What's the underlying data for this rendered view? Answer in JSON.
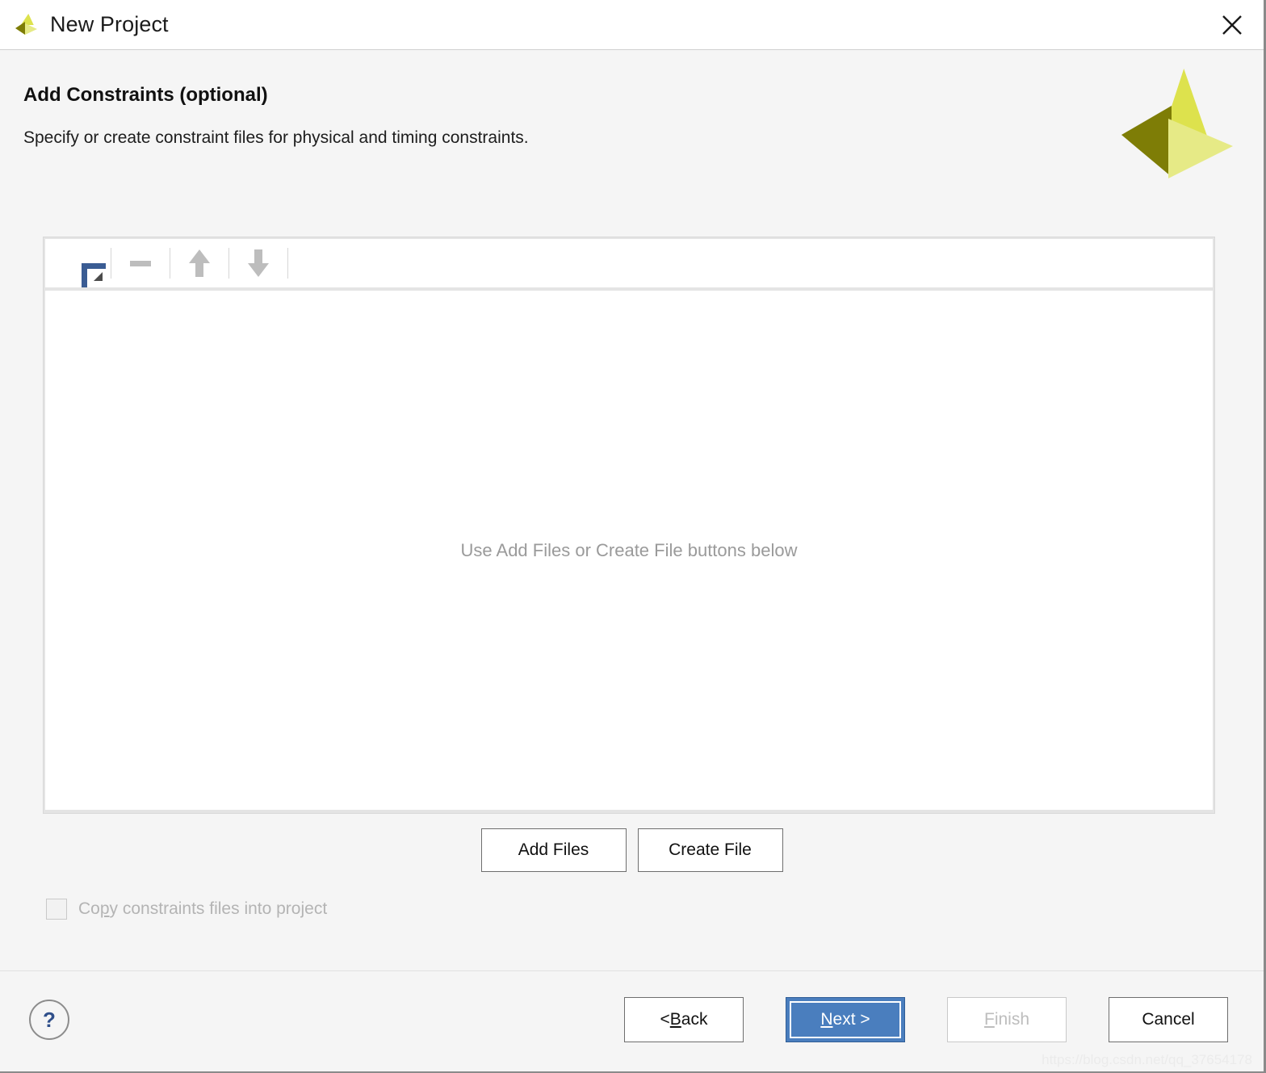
{
  "window": {
    "title": "New Project",
    "close_icon": "close-icon",
    "logo_icon": "xilinx-logo-icon"
  },
  "header": {
    "title": "Add Constraints (optional)",
    "subtitle": "Specify or create constraint files for physical and timing constraints."
  },
  "panel": {
    "toolbar": {
      "add_icon": "plus-icon",
      "remove_icon": "minus-icon",
      "move_up_icon": "arrow-up-icon",
      "move_down_icon": "arrow-down-icon"
    },
    "empty_message": "Use Add Files or Create File buttons below"
  },
  "file_buttons": {
    "add_files": "Add Files",
    "create_file": "Create File"
  },
  "options": {
    "copy_constraints": {
      "label_before": "Co",
      "label_mnemonic": "p",
      "label_after": "y constraints files into project",
      "checked": false,
      "enabled": false
    }
  },
  "footer": {
    "help_icon": "?",
    "back": {
      "prefix": "< ",
      "mnemonic": "B",
      "suffix": "ack"
    },
    "next": {
      "prefix": "",
      "mnemonic": "N",
      "suffix": "ext >"
    },
    "finish": {
      "prefix": "",
      "mnemonic": "F",
      "suffix": "inish"
    },
    "cancel": "Cancel",
    "watermark": "https://blog.csdn.net/qq_37654178"
  },
  "colors": {
    "accent_blue": "#4a7ebe",
    "plus_blue": "#3a5c93",
    "logo_yellow": "#dde24d",
    "logo_olive": "#7e7d06",
    "logo_pale": "#e6ea86"
  }
}
